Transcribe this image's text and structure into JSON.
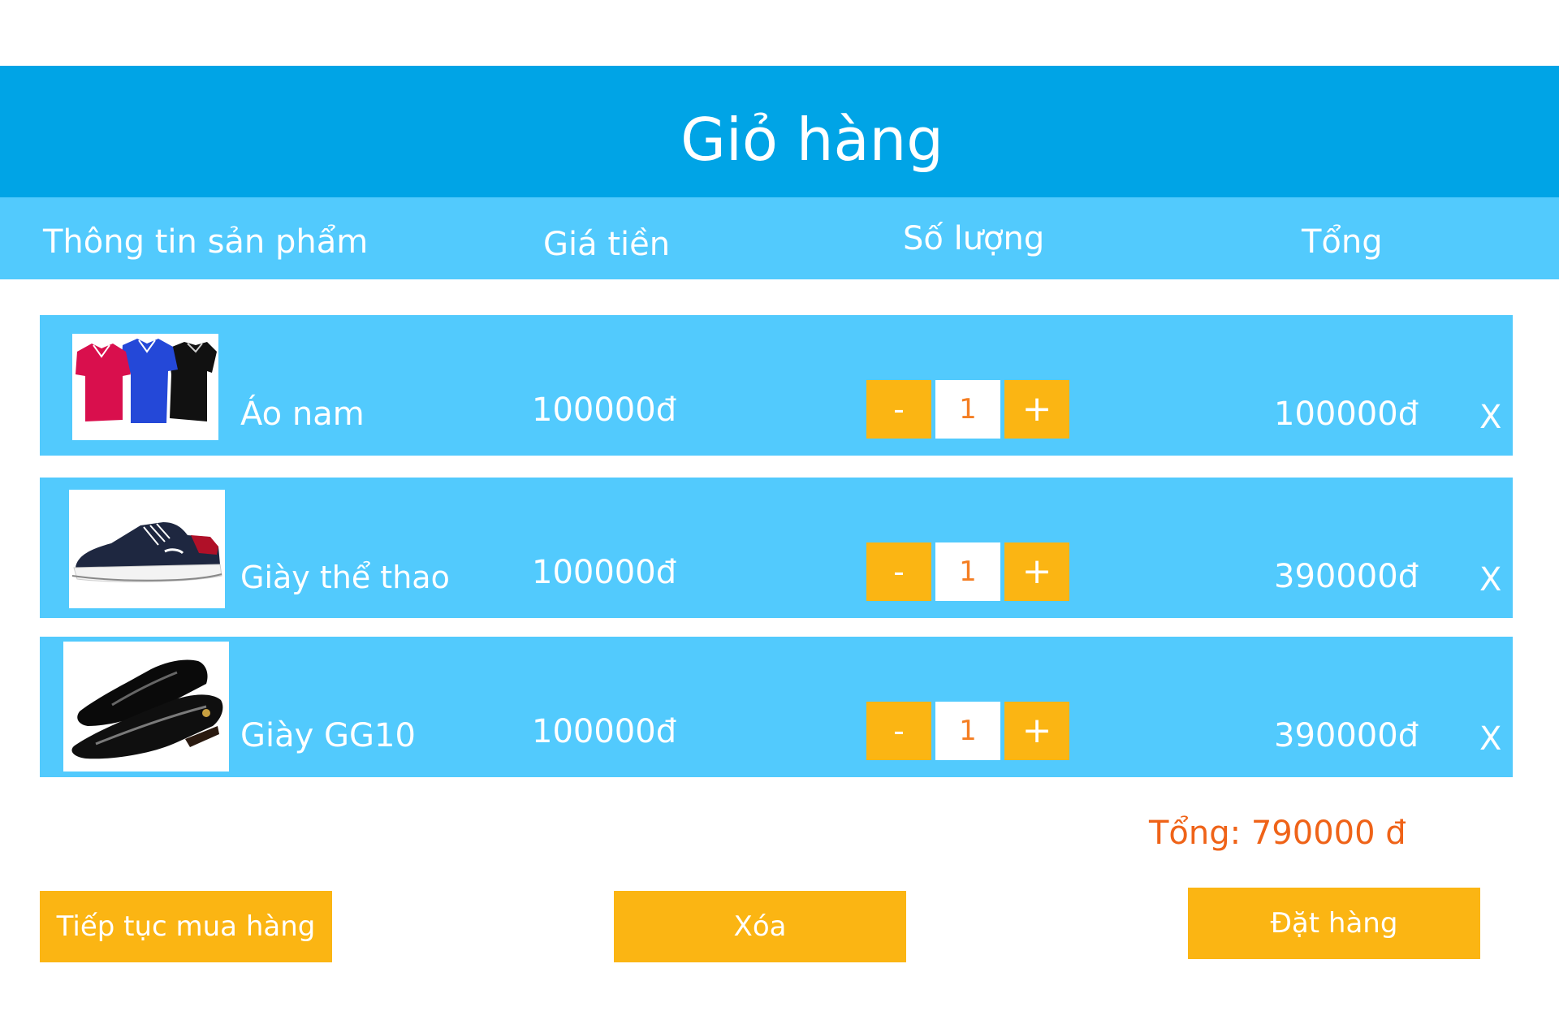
{
  "header": {
    "title": "Giỏ hàng"
  },
  "columns": {
    "product_info": "Thông tin sản phẩm",
    "price": "Giá tiền",
    "quantity": "Số lượng",
    "total": "Tổng"
  },
  "items": [
    {
      "name": "Áo nam",
      "image": "polo-shirts-image",
      "price": "100000đ",
      "qty": "1",
      "total": "100000đ",
      "decrement": "-",
      "increment": "+",
      "remove": "X"
    },
    {
      "name": "Giày thể thao",
      "image": "sneaker-image",
      "price": "100000đ",
      "qty": "1",
      "total": "390000đ",
      "decrement": "-",
      "increment": "+",
      "remove": "X"
    },
    {
      "name": "Giày GG10",
      "image": "loafer-shoes-image",
      "price": "100000đ",
      "qty": "1",
      "total": "390000đ",
      "decrement": "-",
      "increment": "+",
      "remove": "X"
    }
  ],
  "summary": {
    "grand_total": "Tổng: 790000 đ"
  },
  "actions": {
    "continue_shopping": "Tiếp tục mua hàng",
    "clear": "Xóa",
    "place_order": "Đặt hàng"
  },
  "colors": {
    "title_bar": "#00a4e6",
    "row_background": "#52cafd",
    "button": "#fbb513",
    "quantity_text": "#f47e22",
    "total_text": "#ef6318"
  }
}
